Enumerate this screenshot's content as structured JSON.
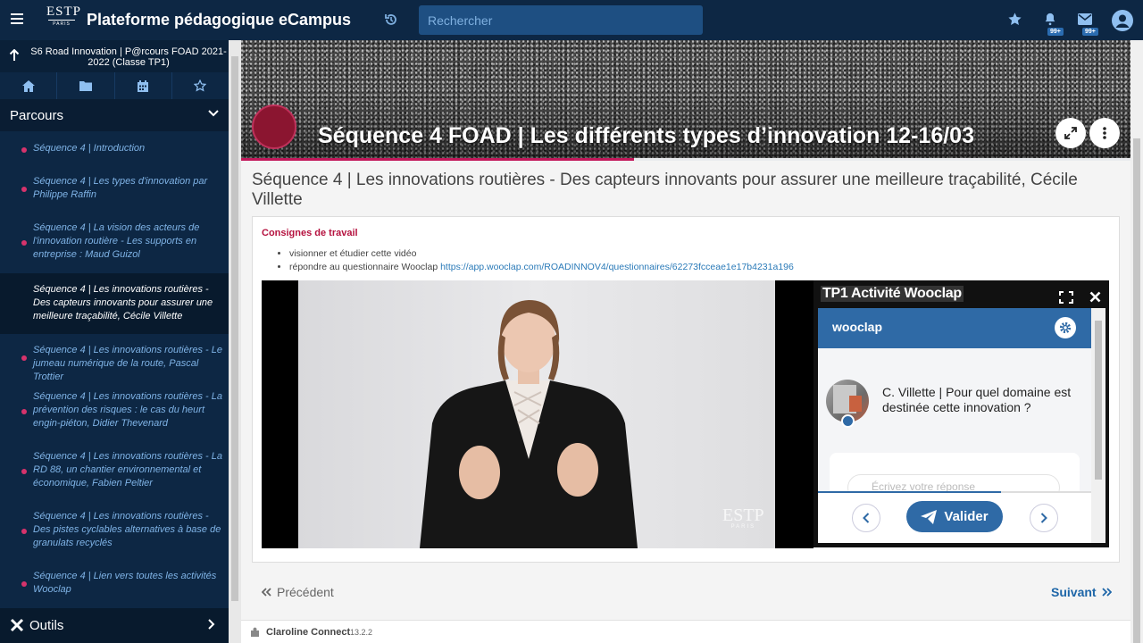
{
  "topbar": {
    "logo_text": "ESTP",
    "logo_sub": "PARIS",
    "app_title": "Plateforme pédagogique eCampus",
    "search_placeholder": "Rechercher",
    "notifications_badge": "99+",
    "messages_badge": "99+"
  },
  "sidebar": {
    "course_name": "S6 Road Innovation | P@rcours FOAD 2021-2022 (Classe TP1)",
    "section_title": "Parcours",
    "items": [
      {
        "label": "Séquence 4 | Introduction"
      },
      {
        "label": "Séquence 4 | Les types d'innovation par Philippe Raffin"
      },
      {
        "label": "Séquence 4 | La vision des acteurs de l'innovation routière - Les supports en entreprise : Maud Guizol"
      },
      {
        "label": "Séquence 4 | Les innovations routières - Des capteurs innovants pour assurer une meilleure traçabilité, Cécile Villette",
        "active": true
      },
      {
        "label": "Séquence 4 | Les innovations routières - Le jumeau numérique de la route, Pascal Trottier"
      },
      {
        "label": "Séquence 4 | Les innovations routières - La prévention des risques : le cas du heurt engin-piéton, Didier Thevenard"
      },
      {
        "label": "Séquence 4 | Les innovations routières - La RD 88, un chantier environnemental et économique, Fabien Peltier"
      },
      {
        "label": "Séquence 4 | Les innovations routières - Des pistes cyclables alternatives à base de granulats recyclés"
      },
      {
        "label": "Séquence 4 | Lien vers toutes les activités Wooclap"
      }
    ],
    "tools_label": "Outils"
  },
  "banner": {
    "title": "Séquence 4 FOAD | Les différents types d’innovation 12-16/03"
  },
  "resource": {
    "title": "Séquence 4 | Les innovations routières - Des capteurs innovants pour assurer une meilleure traçabilité, Cécile Villette",
    "instructions_heading": "Consignes de travail",
    "instruction_1": "visionner et étudier cette vidéo",
    "instruction_2_text": "répondre au questionnaire Wooclap ",
    "instruction_2_link": "https://app.wooclap.com/ROADINNOV4/questionnaires/62273fcceae1e17b4231a196",
    "video_watermark": "ESTP",
    "video_watermark_sub": "PARIS"
  },
  "wooclap": {
    "panel_title": "TP1 Activité Wooclap",
    "brand": "wooclap",
    "question": "C. Villette | Pour quel domaine est destinée cette innovation ?",
    "answer_placeholder": "Écrivez votre réponse",
    "submit_label": "Valider",
    "progress": 0.67
  },
  "nav": {
    "previous": "Précédent",
    "next": "Suivant"
  },
  "footer": {
    "brand": "Claroline Connect",
    "version": "13.2.2"
  },
  "colors": {
    "navy": "#0d2744",
    "accent_pink": "#c2185b",
    "link_blue": "#1e66a8",
    "wooclap_blue": "#2f6aa6"
  }
}
